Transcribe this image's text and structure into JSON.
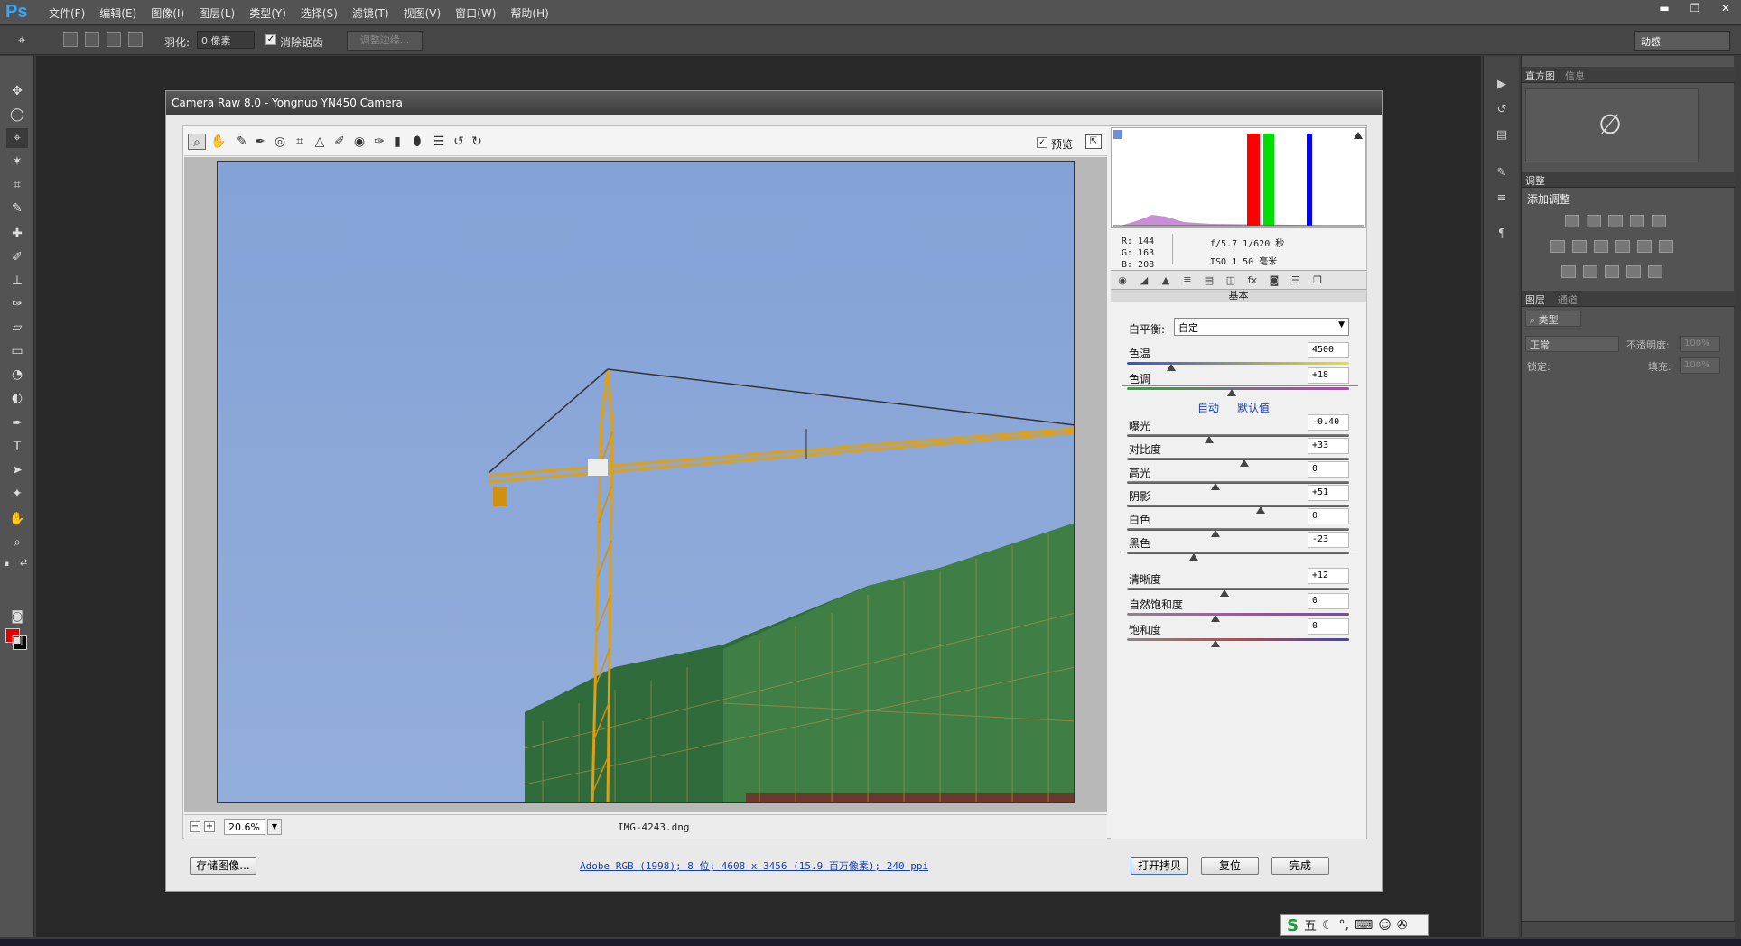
{
  "app": {
    "logo": "Ps"
  },
  "menu": [
    "文件(F)",
    "编辑(E)",
    "图像(I)",
    "图层(L)",
    "类型(Y)",
    "选择(S)",
    "滤镜(T)",
    "视图(V)",
    "窗口(W)",
    "帮助(H)"
  ],
  "window_controls": {
    "minimize": "▬",
    "restore": "❐",
    "close": "✕"
  },
  "options": {
    "feather_label": "羽化:",
    "feather_value": "0 像素",
    "antialias_checked": "✓",
    "antialias_label": "消除锯齿",
    "refine_edge": "调整边缘...",
    "workspace": "动感"
  },
  "panels": {
    "histogram_tab": "直方图",
    "info_tab": "信息",
    "no_histogram": "∅",
    "adjust_tab": "调整",
    "add_adjustment": "添加调整",
    "layers_tab": "图层",
    "channels_tab": "通道",
    "kind_filter": "⌕ 类型",
    "blend_mode": "正常",
    "opacity_label": "不透明度:",
    "opacity_value": "100%",
    "lock_label": "锁定:",
    "fill_label": "填充:",
    "fill_value": "100%"
  },
  "dialog": {
    "title": "Camera Raw 8.0 -  Yongnuo YN450 Camera",
    "preview_checked": "✓",
    "preview_label": "预览",
    "zoom_value": "20.6%",
    "zoom_minus": "−",
    "zoom_plus": "+",
    "filename": "IMG-4243.dng",
    "readout": {
      "r": "R:  144",
      "g": "G:  163",
      "b": "B:  208",
      "exposure_line": "f/5.7   1/620 秒",
      "iso_line": "ISO 1   50 毫米"
    },
    "panel_title": "基本",
    "white_balance_label": "白平衡:",
    "white_balance_value": "自定",
    "auto_link": "自动",
    "default_link": "默认值",
    "sliders": [
      {
        "label": "色温",
        "value": "4500",
        "pos": 0.2
      },
      {
        "label": "色调",
        "value": "+18",
        "pos": 0.47
      },
      {
        "label": "曝光",
        "value": "-0.40",
        "pos": 0.37
      },
      {
        "label": "对比度",
        "value": "+33",
        "pos": 0.53
      },
      {
        "label": "高光",
        "value": "0",
        "pos": 0.4
      },
      {
        "label": "阴影",
        "value": "+51",
        "pos": 0.6
      },
      {
        "label": "白色",
        "value": "0",
        "pos": 0.4
      },
      {
        "label": "黑色",
        "value": "-23",
        "pos": 0.3
      },
      {
        "label": "清晰度",
        "value": "+12",
        "pos": 0.44
      },
      {
        "label": "自然饱和度",
        "value": "0",
        "pos": 0.4
      },
      {
        "label": "饱和度",
        "value": "0",
        "pos": 0.4
      }
    ],
    "save_button": "存储图像...",
    "workflow_options": "Adobe RGB (1998); 8 位; 4608 x 3456 (15.9 百万像素); 240 ppi",
    "open_copy_button": "打开拷贝",
    "reset_button": "复位",
    "done_button": "完成"
  },
  "ime": {
    "logo": "S",
    "mode": "五"
  },
  "colors": {
    "accent": "#31a8ff",
    "foreground": "#e00000",
    "background": "#000000"
  }
}
